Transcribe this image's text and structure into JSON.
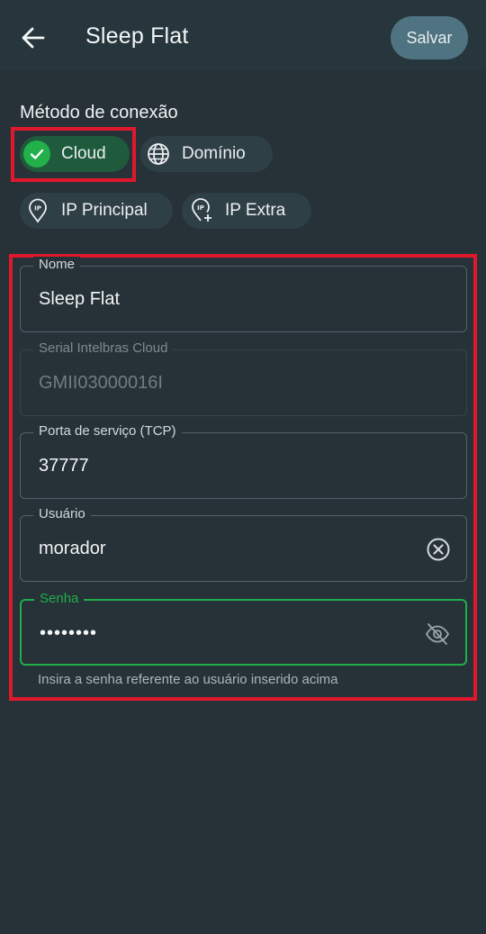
{
  "header": {
    "title": "Sleep Flat",
    "save_label": "Salvar"
  },
  "connection": {
    "label": "Método de conexão",
    "chips": [
      {
        "label": "Cloud",
        "icon": "check-icon",
        "selected": true
      },
      {
        "label": "Domínio",
        "icon": "globe-icon",
        "selected": false
      },
      {
        "label": "IP Principal",
        "icon": "ip-pin-icon",
        "selected": false
      },
      {
        "label": "IP Extra",
        "icon": "ip-pin-plus-icon",
        "selected": false
      }
    ]
  },
  "form": {
    "name": {
      "label": "Nome",
      "value": "Sleep Flat"
    },
    "serial": {
      "label": "Serial Intelbras Cloud",
      "value": "GMII03000016I"
    },
    "port": {
      "label": "Porta de serviço (TCP)",
      "value": "37777"
    },
    "user": {
      "label": "Usuário",
      "value": "morador"
    },
    "password": {
      "label": "Senha",
      "value": "••••••••",
      "helper": "Insira a senha referente ao usuário inserido acima"
    }
  },
  "colors": {
    "background": "#263238",
    "accent_green": "#1fae4a",
    "highlight_red": "#e0182d",
    "save_button": "#4f7380"
  }
}
